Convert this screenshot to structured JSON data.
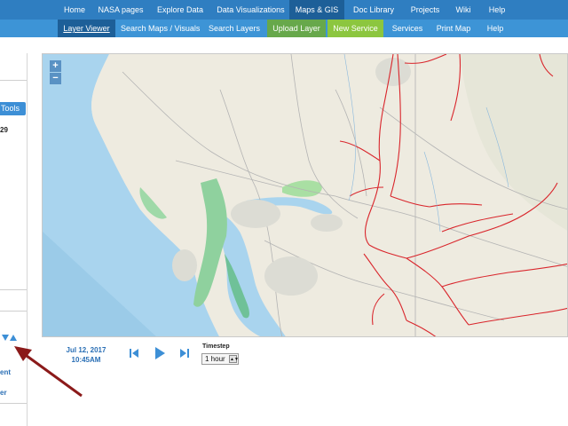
{
  "topnav": {
    "items": [
      {
        "label": "Home"
      },
      {
        "label": "NASA pages"
      },
      {
        "label": "Explore Data"
      },
      {
        "label": "Data Visualizations"
      },
      {
        "label": "Maps & GIS"
      },
      {
        "label": "Doc Library"
      },
      {
        "label": "Projects"
      },
      {
        "label": "Wiki"
      },
      {
        "label": "Help"
      }
    ],
    "active": "Maps & GIS"
  },
  "subnav": {
    "items": [
      {
        "label": "Layer Viewer"
      },
      {
        "label": "Search Maps / Visuals"
      },
      {
        "label": "Search Layers"
      },
      {
        "label": "Upload Layer"
      },
      {
        "label": "New Service"
      },
      {
        "label": "Services"
      },
      {
        "label": "Print Map"
      },
      {
        "label": "Help"
      }
    ],
    "active": "Layer Viewer"
  },
  "leftpanel": {
    "tools_label": "Tools",
    "number_text": "29",
    "link1": "ent",
    "link2": "er"
  },
  "map": {
    "zoom_in": "+",
    "zoom_out": "−"
  },
  "time": {
    "date": "Jul 12, 2017",
    "time": "10:45AM",
    "timestep_label": "Timestep",
    "timestep_value": "1 hour"
  },
  "colors": {
    "nav": "#2f7ec1",
    "subnav": "#3d94d6",
    "active": "#1d5f98",
    "upload": "#67a84b",
    "new_service": "#8cc63f",
    "water": "#a8d4ee",
    "levee_lines": "#d9252b",
    "annotation_arrow": "#8b1a1a"
  }
}
